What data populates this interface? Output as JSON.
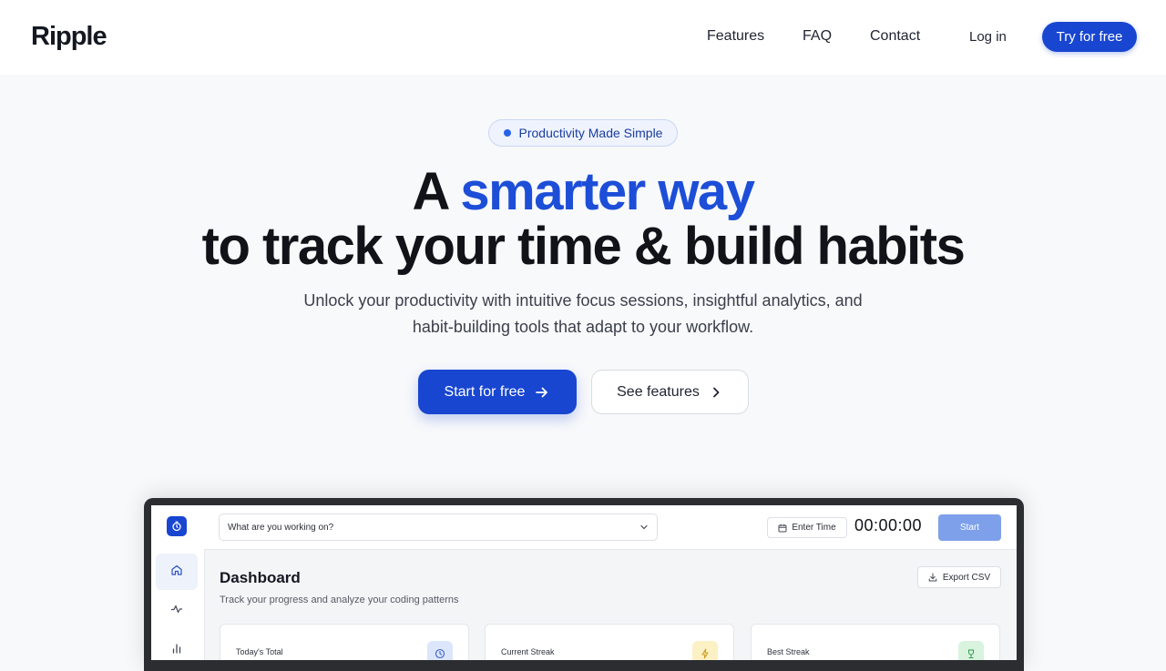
{
  "header": {
    "logo": "Ripple",
    "nav": [
      "Features",
      "FAQ",
      "Contact"
    ],
    "login": "Log in",
    "cta": "Try for free"
  },
  "hero": {
    "pill": "Productivity Made Simple",
    "title_prefix": "A ",
    "title_accent": "smarter way",
    "title_line2": "to track your time & build habits",
    "subtitle_line1": "Unlock your productivity with intuitive focus sessions, insightful analytics, and",
    "subtitle_line2": "habit-building tools that adapt to your workflow.",
    "primary_button": "Start for free",
    "secondary_button": "See features"
  },
  "app": {
    "task_placeholder": "What are you working on?",
    "enter_time": "Enter Time",
    "timer": "00:00:00",
    "start": "Start",
    "dashboard_title": "Dashboard",
    "dashboard_subtitle": "Track your progress and analyze your coding patterns",
    "export": "Export CSV",
    "cards": [
      {
        "label": "Today's Total",
        "icon": "clock-icon",
        "color": "#dbe6fb"
      },
      {
        "label": "Current Streak",
        "icon": "lightning-icon",
        "color": "#fcf1c4"
      },
      {
        "label": "Best Streak",
        "icon": "trophy-icon",
        "color": "#d9f3df"
      }
    ]
  },
  "colors": {
    "accent": "#1d4ed8",
    "button": "#1846d1"
  }
}
